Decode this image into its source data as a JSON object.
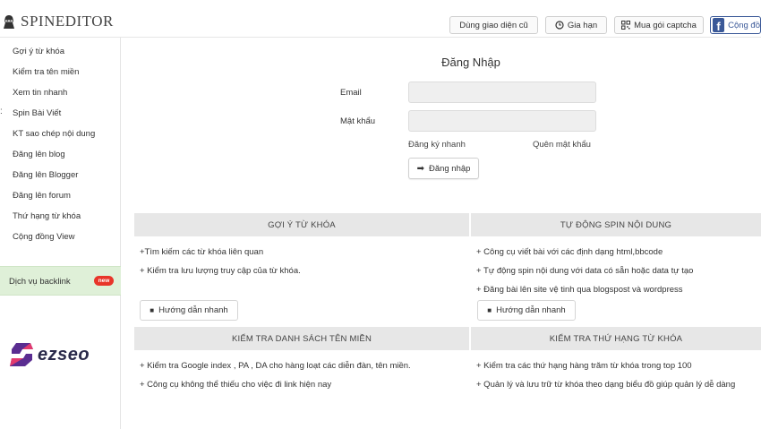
{
  "header": {
    "logo_text": "SPINEDITOR",
    "buttons": {
      "old_ui": "Dùng giao diện cũ",
      "renew": "Gia hạn",
      "captcha": "Mua gói captcha",
      "community": "Cộng đồ"
    }
  },
  "sidebar": {
    "items": [
      "Gợi ý từ khóa",
      "Kiểm tra tên miền",
      "Xem tin nhanh",
      "Spin Bài Viết",
      "KT sao chép nội dung",
      "Đăng lên blog",
      "Đăng lên Blogger",
      "Đăng lên forum",
      "Thứ hạng từ khóa",
      "Cộng đồng View"
    ],
    "backlink_label": "Dịch vụ backlink",
    "backlink_badge": "new",
    "brand_text": "ezseo"
  },
  "login": {
    "title": "Đăng Nhập",
    "email_label": "Email",
    "email_value": "",
    "password_label": "Mật khẩu",
    "password_value": "",
    "register_link": "Đăng ký nhanh",
    "forgot_link": "Quên mật khẩu",
    "submit": "Đăng nhập"
  },
  "panels": {
    "keyword": {
      "title": "GỢI Ý TỪ KHÓA",
      "bullets": [
        "+Tìm kiếm các từ khóa liên quan",
        "+ Kiểm tra lưu lượng truy cập của từ khóa."
      ],
      "guide": "Hướng dẫn nhanh"
    },
    "spin": {
      "title": "TỰ ĐỘNG SPIN NỘI DUNG",
      "bullets": [
        "+ Công cụ viết bài với các định dạng html,bbcode",
        "+ Tự động spin nội dung với data có sẵn hoặc data tự tạo",
        "+ Đăng bài lên site vệ tinh qua blogspost và wordpress"
      ],
      "guide": "Hướng dẫn nhanh"
    },
    "domain": {
      "title": "KIỂM TRA DANH SÁCH TÊN MIỀN",
      "bullets": [
        "+ Kiểm tra Google index , PA , DA cho hàng loạt các diễn đàn, tên miền.",
        "+ Công cụ không thể thiếu cho việc đi link hiện nay"
      ]
    },
    "rank": {
      "title": "KIỂM TRA THỨ HẠNG TỪ KHÓA",
      "bullets": [
        "+ Kiểm tra các thứ hạng hàng trăm từ khóa trong top 100",
        "+ Quản lý và lưu trữ từ khóa theo dạng biểu đồ giúp quản lý dễ dàng"
      ]
    }
  },
  "colors": {
    "facebook": "#3b5998",
    "sidebar_highlight": "#dff0d8",
    "badge": "#e8352a",
    "panel_header": "#e7e7e7",
    "brand": "#5a2d91"
  }
}
